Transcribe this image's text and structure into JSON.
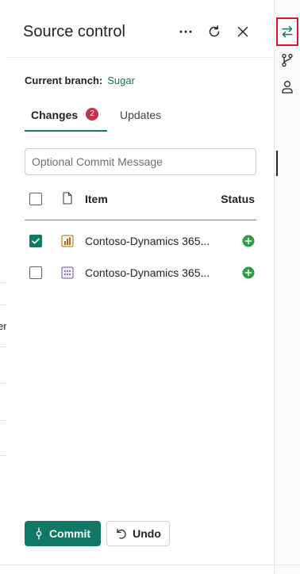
{
  "panel": {
    "title": "Source control",
    "branch_label": "Current branch:",
    "branch_value": "Sugar"
  },
  "tabs": [
    {
      "label": "Changes",
      "badge": "2",
      "selected": true
    },
    {
      "label": "Updates",
      "selected": false
    }
  ],
  "commit_message": {
    "placeholder": "Optional Commit Message",
    "value": ""
  },
  "table": {
    "columns": {
      "item": "Item",
      "status": "Status"
    },
    "rows": [
      {
        "name": "Contoso-Dynamics 365...",
        "type_icon": "report-icon",
        "checked": true,
        "status": "added"
      },
      {
        "name": "Contoso-Dynamics 365...",
        "type_icon": "dataset-icon",
        "checked": false,
        "status": "added"
      }
    ]
  },
  "buttons": {
    "commit": "Commit",
    "undo": "Undo"
  },
  "background": {
    "partial_text": "er"
  },
  "colors": {
    "accent": "#117865",
    "badge": "#c4314b",
    "added": "#2e9e44",
    "highlight": "#e81123"
  }
}
